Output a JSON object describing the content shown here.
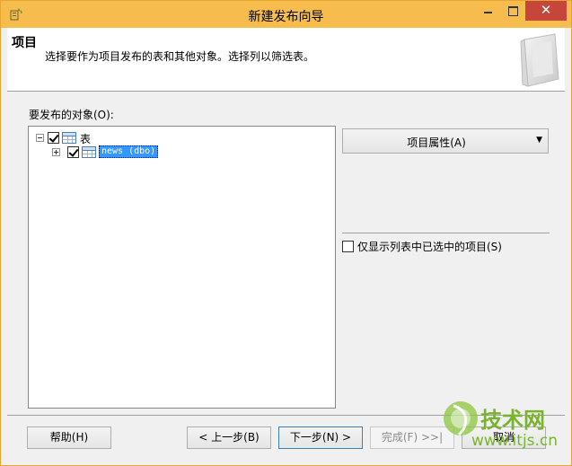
{
  "window": {
    "title": "新建发布向导",
    "close_label": "✕",
    "colors": {
      "titlebar": "#f6bd4e",
      "close": "#c7463c",
      "selection": "#3399ff"
    }
  },
  "header": {
    "title": "项目",
    "description": "选择要作为项目发布的表和其他对象。选择列以筛选表。"
  },
  "objects": {
    "label": "要发布的对象(O):",
    "tree": [
      {
        "label": "表",
        "expanded": true,
        "checked": true,
        "icon": "table-icon"
      },
      {
        "label": "news (dbo)",
        "expanded": false,
        "checked": true,
        "icon": "table-icon",
        "selected": true
      }
    ]
  },
  "properties_button": {
    "label": "项目属性(A)",
    "icon": "dropdown-arrow-icon"
  },
  "only_selected": {
    "label": "仅显示列表中已选中的项目(S)",
    "checked": false
  },
  "footer": {
    "help": "帮助(H)",
    "prev": "< 上一步(B)",
    "next": "下一步(N) >",
    "finish": "完成(F) >>|",
    "cancel": "取消"
  },
  "watermark": {
    "brand": "技术网",
    "url": "www.itjs.cn"
  }
}
